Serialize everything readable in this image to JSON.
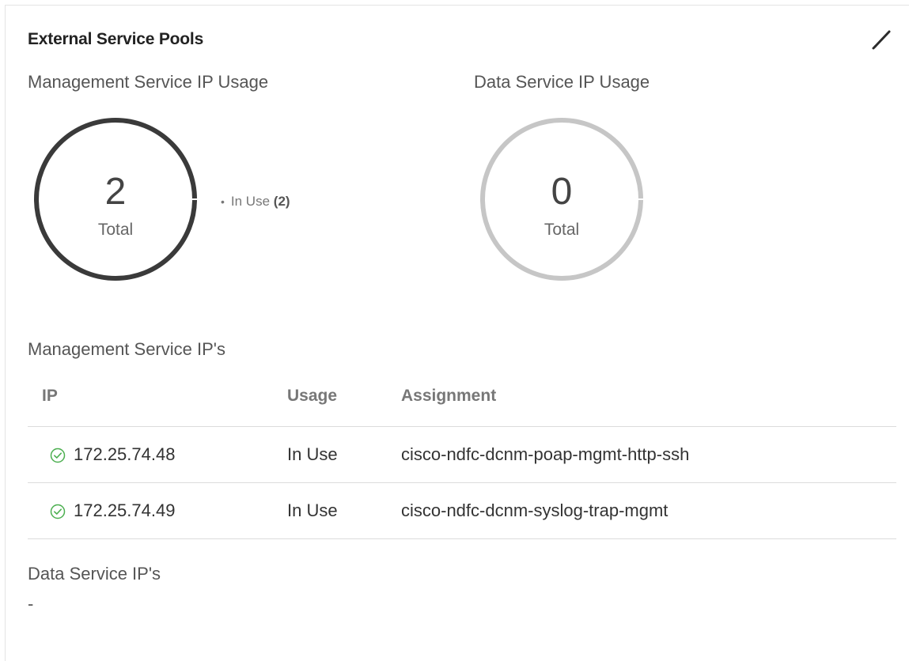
{
  "card": {
    "title": "External Service Pools",
    "edit_icon": "pencil-icon"
  },
  "management_usage": {
    "label": "Management Service IP Usage",
    "total": "2",
    "caption": "Total",
    "legend_label": "In Use",
    "legend_count": "(2)",
    "in_use_fraction": 1.0,
    "ring_color": "#3a3a3a"
  },
  "data_usage": {
    "label": "Data Service IP Usage",
    "total": "0",
    "caption": "Total",
    "ring_color": "#c6c6c6"
  },
  "management_ips": {
    "label": "Management Service IP's",
    "columns": [
      "IP",
      "Usage",
      "Assignment"
    ],
    "rows": [
      {
        "ip": "172.25.74.48",
        "usage": "In Use",
        "assignment": "cisco-ndfc-dcnm-poap-mgmt-http-ssh",
        "status_icon": "check-circle-icon"
      },
      {
        "ip": "172.25.74.49",
        "usage": "In Use",
        "assignment": "cisco-ndfc-dcnm-syslog-trap-mgmt",
        "status_icon": "check-circle-icon"
      }
    ],
    "status_color": "#4caf50"
  },
  "data_ips": {
    "label": "Data Service IP's",
    "empty_value": "-"
  }
}
